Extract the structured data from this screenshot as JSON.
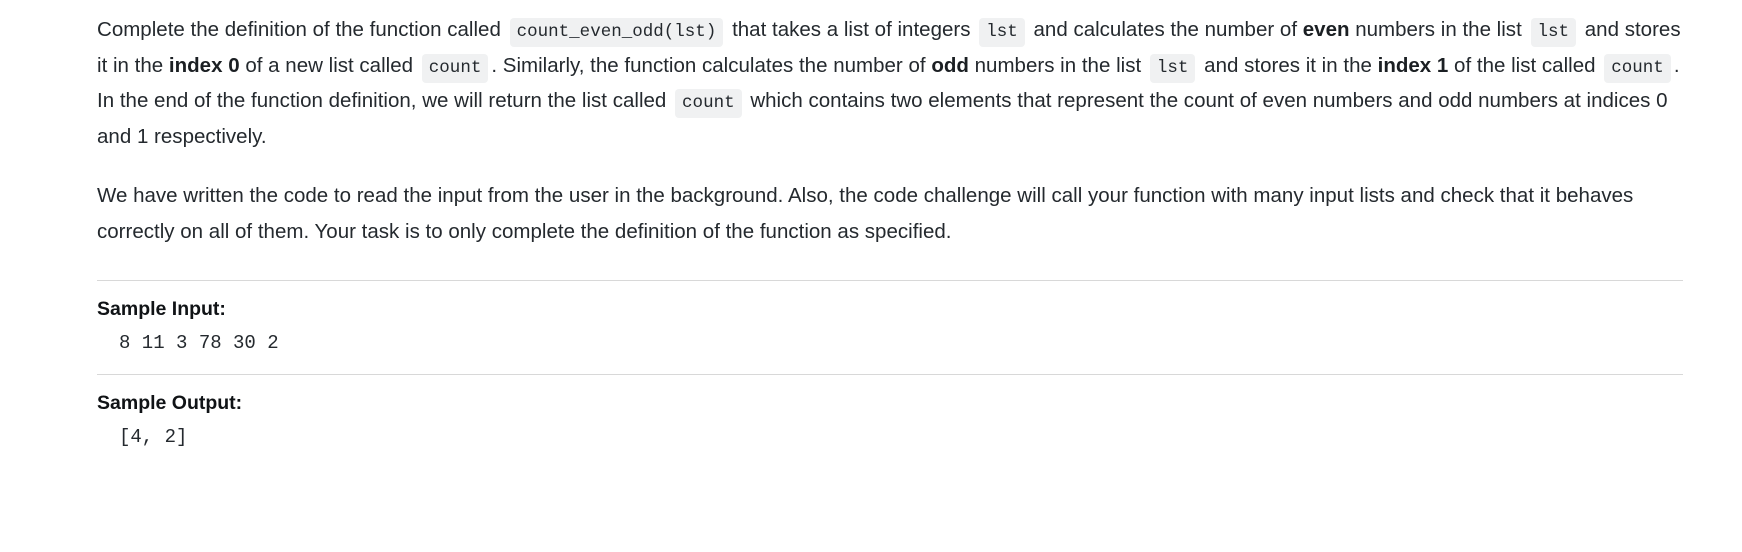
{
  "problem": {
    "paragraph1": {
      "seg1": "Complete the definition of the function called",
      "code1": "count_even_odd(lst)",
      "seg2": "that takes a list of integers",
      "code2": "lst",
      "seg3": "and calculates the number of",
      "bold1": "even",
      "seg4": "numbers in the list",
      "code3": "lst",
      "seg5": "and stores it in the",
      "bold2": "index 0",
      "seg6": "of a new list called",
      "code4": "count",
      "seg7": ". Similarly, the function calculates the number of",
      "bold3": "odd",
      "seg8": "numbers in the list",
      "code5": "lst",
      "seg9": "and stores it in the",
      "bold4": "index 1",
      "seg10": "of the list called",
      "code6": "count",
      "seg11": ".  In the end of the function definition, we will return the list called",
      "code7": "count",
      "seg12": "which contains two elements that represent the count of even numbers and odd numbers at indices 0 and 1 respectively."
    },
    "paragraph2": "We have written the code to read the input from the user in the background. Also, the code challenge will call your function with many input lists and check that it behaves correctly on all of them. Your task is to only complete the definition of the function as specified.",
    "sample_input": {
      "title": "Sample Input:",
      "value": "8 11 3 78 30 2"
    },
    "sample_output": {
      "title": "Sample Output:",
      "value": "[4, 2]"
    }
  },
  "colors": {
    "code_chip_bg": "#f0f1f2",
    "text": "#24292e",
    "rule": "#d8d8d8",
    "page_bg": "#ffffff"
  }
}
